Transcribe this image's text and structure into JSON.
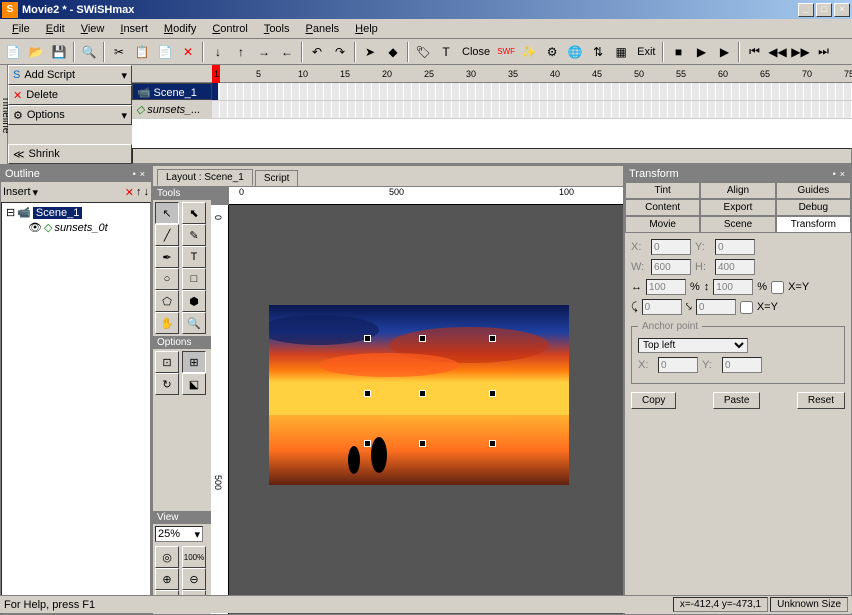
{
  "window": {
    "title": "Movie2 * - SWiSHmax"
  },
  "menu": [
    "File",
    "Edit",
    "View",
    "Insert",
    "Modify",
    "Control",
    "Tools",
    "Panels",
    "Help"
  ],
  "toolbar": {
    "close": "Close",
    "exit": "Exit"
  },
  "timeline": {
    "side_label": "Timeline",
    "btns": {
      "add_script": "Add Script",
      "delete": "Delete",
      "options": "Options",
      "shrink": "Shrink"
    },
    "scene_label": "Scene_1",
    "layer_label": "sunsets_...",
    "ticks": [
      1,
      5,
      10,
      15,
      20,
      25,
      30,
      35,
      40,
      45,
      50,
      55,
      60,
      65,
      70,
      75
    ]
  },
  "outline": {
    "title": "Outline",
    "insert": "Insert",
    "tree": {
      "scene": "Scene_1",
      "layer": "sunsets_0t"
    }
  },
  "layout": {
    "tab_layout": "Layout : Scene_1",
    "tab_script": "Script",
    "tools_header": "Tools",
    "options_header": "Options",
    "view_header": "View",
    "zoom": "25%",
    "ruler_h": [
      "0",
      "500",
      "100"
    ],
    "ruler_v": [
      "0",
      "500"
    ]
  },
  "transform": {
    "title": "Transform",
    "tabs": [
      "Tint",
      "Align",
      "Guides",
      "Content",
      "Export",
      "Debug",
      "Movie",
      "Scene",
      "Transform"
    ],
    "x": "0",
    "y": "0",
    "w": "600",
    "h": "400",
    "sx": "100",
    "sy": "100",
    "r1": "0",
    "r2": "0",
    "xy_lock": "X=Y",
    "anchor_legend": "Anchor point",
    "anchor": "Top left",
    "ax": "0",
    "ay": "0",
    "copy": "Copy",
    "paste": "Paste",
    "reset": "Reset"
  },
  "status": {
    "help": "For Help, press F1",
    "coords": "x=-412,4 y=-473,1",
    "size": "Unknown Size"
  }
}
